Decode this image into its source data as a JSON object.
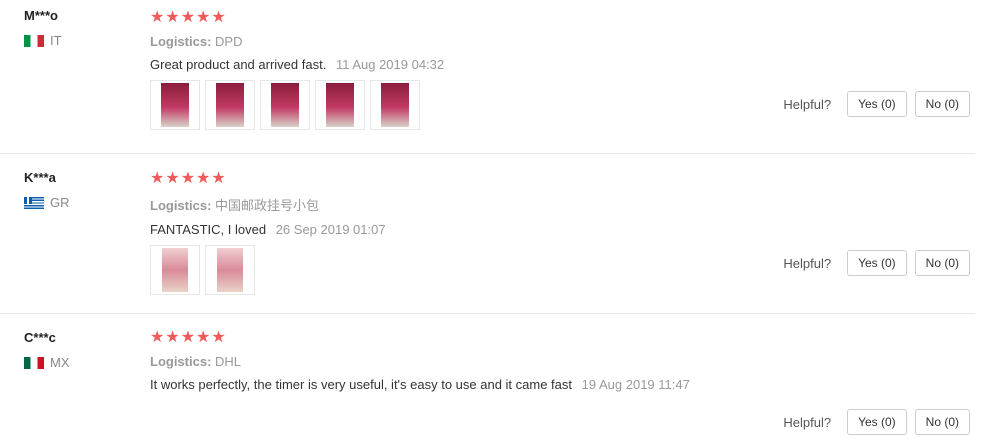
{
  "helpful_label": "Helpful?",
  "star_glyphs": "★★★★★",
  "logistics_label": "Logistics:",
  "reviews": [
    {
      "user": "M***o",
      "country": "IT",
      "logistics": "DPD",
      "text": "Great product and arrived fast.",
      "date": "11 Aug 2019 04:32",
      "yes": "Yes (0)",
      "no": "No (0)"
    },
    {
      "user": "K***a",
      "country": "GR",
      "logistics": "中国邮政挂号小包",
      "text": "FANTASTIC, I loved",
      "date": "26 Sep 2019 01:07",
      "yes": "Yes (0)",
      "no": "No (0)"
    },
    {
      "user": "C***c",
      "country": "MX",
      "logistics": "DHL",
      "text": "It works perfectly, the timer is very useful, it's easy to use and it came fast",
      "date": "19 Aug 2019 11:47",
      "yes": "Yes (0)",
      "no": "No (0)"
    }
  ]
}
